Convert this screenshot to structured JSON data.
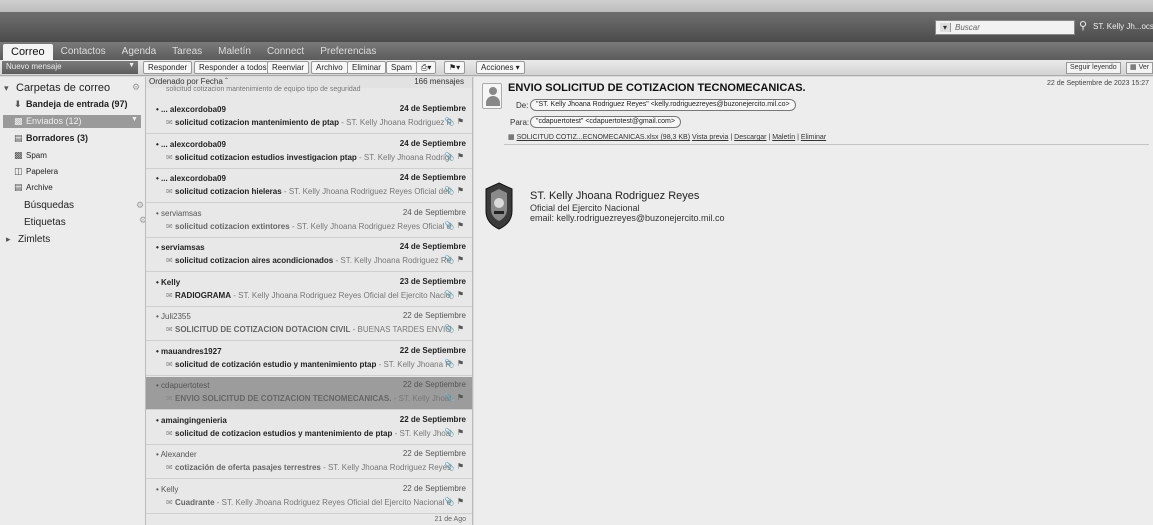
{
  "header": {
    "search_scope": "▾",
    "search_placeholder": "Buscar",
    "user": "ST. Kelly Jh...ocs Reyes"
  },
  "tabs": [
    "Correo",
    "Contactos",
    "Agenda",
    "Tareas",
    "Maletín",
    "Connect",
    "Preferencias"
  ],
  "toolbar": {
    "new_message": "Nuevo mensaje",
    "reply": "Responder",
    "reply_all": "Responder a todos",
    "forward": "Reenviar",
    "archive": "Archivo",
    "delete": "Eliminar",
    "spam": "Spam",
    "actions": "Acciones ▾",
    "keep_reading": "Seguir leyendo",
    "view": "Ver"
  },
  "sidebar": {
    "folders_header": "Carpetas de correo",
    "folders": [
      {
        "label": "Bandeja de entrada (97)",
        "icon": "inbox-icon"
      },
      {
        "label": "Enviados (12)",
        "icon": "sent-icon"
      },
      {
        "label": "Borradores (3)",
        "icon": "drafts-icon"
      },
      {
        "label": "Spam",
        "icon": "spam-icon"
      },
      {
        "label": "Papelera",
        "icon": "trash-icon"
      },
      {
        "label": "Archive",
        "icon": "archive-icon"
      }
    ],
    "searches": "Búsquedas",
    "tags": "Etiquetas",
    "zimlets": "Zimlets"
  },
  "list": {
    "sort_label": "Ordenado por Fecha",
    "count": "166 mensajes",
    "partial_top": "solicitud cotizacion mantenimiento de equipo tipo de seguridad",
    "messages": [
      {
        "sender": "... alexcordoba09",
        "date": "24 de Septiembre",
        "subject": "solicitud cotizacion mantenimiento de ptap",
        "fragment": " - ST. Kelly Jhoana Rodriguez Reyes",
        "unread": true
      },
      {
        "sender": "... alexcordoba09",
        "date": "24 de Septiembre",
        "subject": "solicitud cotizacion estudios investigacion ptap",
        "fragment": " - ST. Kelly Jhoana Rodriguez Re",
        "unread": true
      },
      {
        "sender": "... alexcordoba09",
        "date": "24 de Septiembre",
        "subject": "solicitud cotizacion hieleras",
        "fragment": " - ST. Kelly Jhoana Rodriguez Reyes Oficial del Ejercito",
        "unread": true
      },
      {
        "sender": "serviamsas",
        "date": "24 de Septiembre",
        "subject": "solicitud cotizacion extintores",
        "fragment": " - ST. Kelly Jhoana Rodriguez Reyes Oficial del Ejercito",
        "unread": false
      },
      {
        "sender": "serviamsas",
        "date": "24 de Septiembre",
        "subject": "solicitud cotizacion aires acondicionados",
        "fragment": " - ST. Kelly Jhoana Rodriguez Reyes Ofi",
        "unread": true
      },
      {
        "sender": "Kelly",
        "date": "23 de Septiembre",
        "subject": "RADIOGRAMA",
        "fragment": " - ST. Kelly Jhoana Rodriguez Reyes Oficial del Ejercito Nacional ema",
        "unread": true
      },
      {
        "sender": "Juli2355",
        "date": "22 de Septiembre",
        "subject": "SOLICITUD DE COTIZACION DOTACION CIVIL",
        "fragment": " - BUENAS TARDES ENVIO SOLICITUD",
        "unread": false
      },
      {
        "sender": "mauandres1927",
        "date": "22 de Septiembre",
        "subject": "solicitud de cotización estudio y mantenimiento ptap",
        "fragment": " - ST. Kelly Jhoana Rodrigu",
        "unread": true
      },
      {
        "sender": "cdapuertotest",
        "date": "22 de Septiembre",
        "subject": "ENVIO SOLICITUD DE COTIZACION TECNOMECANICAS.",
        "fragment": " - ST. Kelly Jhoana Rodrigu",
        "unread": false,
        "selected": true
      },
      {
        "sender": "amaingingenieria",
        "date": "22 de Septiembre",
        "subject": "solicitud de cotizacion estudios y mantenimiento de ptap",
        "fragment": " - ST. Kelly Jhoana Ro",
        "unread": true
      },
      {
        "sender": "Alexander",
        "date": "22 de Septiembre",
        "subject": "cotización de oferta pasajes terrestres",
        "fragment": " - ST. Kelly Jhoana Rodriguez Reyes Oficial d",
        "unread": false
      },
      {
        "sender": "Kelly",
        "date": "22 de Septiembre",
        "subject": "Cuadrante",
        "fragment": " - ST. Kelly Jhoana Rodriguez Reyes Oficial del Ejercito Nacional ema",
        "unread": false
      }
    ],
    "bottom_date": "21 de Ago"
  },
  "reading": {
    "subject": "ENVIO SOLICITUD DE COTIZACION TECNOMECANICAS.",
    "date": "22 de Septiembre de 2023 15:27",
    "from_label": "De:",
    "from": "\"ST. Kelly Jhoana Rodriguez Reyes\" <kelly.rodriguezreyes@buzonejercito.mil.co>",
    "to_label": "Para:",
    "to": "\"cdapuertotest\" <cdapuertotest@gmail.com>",
    "attachment_name": "SOLICITUD COTIZ...ECNOMECANICAS.xlsx (98,3 KB)",
    "attachment_actions": [
      "Vista previa",
      "Descargar",
      "Maletín",
      "Eliminar"
    ],
    "signature": {
      "name": "ST. Kelly Jhoana Rodriguez Reyes",
      "role": "Oficial del Ejercito Nacional",
      "email": "email: kelly.rodriguezreyes@buzonejercito.mil.co"
    }
  }
}
